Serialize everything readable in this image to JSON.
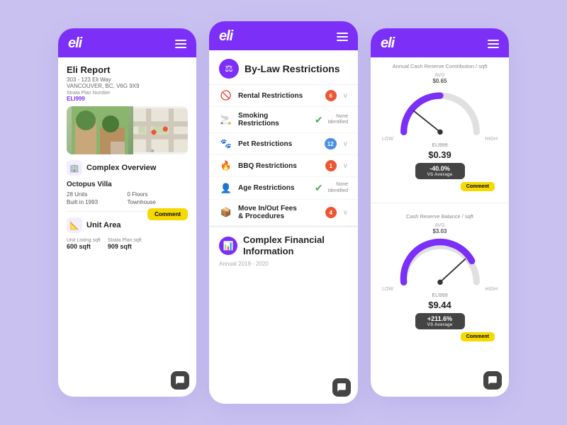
{
  "app": {
    "logo": "eli",
    "menu_icon": "hamburger"
  },
  "card1": {
    "header": {
      "logo": "eli"
    },
    "report_title": "Eli Report",
    "address": "303 - 123 Eli Way\nVANCOUVER, BC, V6G 9X9",
    "strata_label": "Strata Plan Number",
    "strata_val": "ELI999",
    "section_title": "Complex Overview",
    "prop_name": "Octopus Villa",
    "units_label": "28 Units",
    "floors_label": "0 Floors",
    "built_label": "Built in 1993",
    "type_label": "Townhouse",
    "comment_btn": "Comment",
    "unit_area_title": "Unit Area",
    "listing_label": "Unit Listing sqft",
    "listing_val": "600 sqft",
    "strata_sqft_label": "Strata Plan sqft",
    "strata_sqft_val": "909 sqft"
  },
  "card2": {
    "header": {
      "logo": "eli"
    },
    "bylaw_title": "By-Law Restrictions",
    "restrictions": [
      {
        "icon": "🚫",
        "label": "Rental Restrictions",
        "badge": "6",
        "badge_type": "red",
        "has_arrow": true,
        "check": false,
        "none_text": ""
      },
      {
        "icon": "🚬",
        "label": "Smoking Restrictions",
        "badge": "",
        "badge_type": "",
        "has_arrow": false,
        "check": true,
        "none_text": "None\nIdentified"
      },
      {
        "icon": "🐾",
        "label": "Pet Restrictions",
        "badge": "12",
        "badge_type": "blue",
        "has_arrow": true,
        "check": false,
        "none_text": ""
      },
      {
        "icon": "🔥",
        "label": "BBQ Restrictions",
        "badge": "1",
        "badge_type": "red",
        "has_arrow": true,
        "check": false,
        "none_text": ""
      },
      {
        "icon": "👤",
        "label": "Age Restrictions",
        "badge": "",
        "badge_type": "",
        "has_arrow": false,
        "check": true,
        "none_text": "None\nIdentified"
      },
      {
        "icon": "📦",
        "label": "Move In/Out Fees\n& Procedures",
        "badge": "4",
        "badge_type": "red",
        "has_arrow": true,
        "check": false,
        "none_text": ""
      }
    ],
    "financial_title": "Complex Financial\nInformation",
    "financial_sub": "Annual 2019 - 2020"
  },
  "card3": {
    "header": {
      "logo": "eli"
    },
    "gauge1": {
      "title": "Annual Cash Reserve Contribution / sqft",
      "avg_label": "AVG",
      "avg_val": "$0.65",
      "eli_tag": "ELI999",
      "price": "$0.39",
      "low": "LOW",
      "high": "HIGH",
      "box_pct": "-40.0%",
      "box_vs": "VS Average"
    },
    "gauge2": {
      "title": "Cash Reserve Balance / sqft",
      "avg_label": "AVG",
      "avg_val": "$3.03",
      "eli_tag": "ELI999",
      "price": "$9.44",
      "low": "LOW",
      "high": "HIGH",
      "box_pct": "+211.6%",
      "box_vs": "VS Average"
    },
    "comment_btn": "Comment"
  }
}
